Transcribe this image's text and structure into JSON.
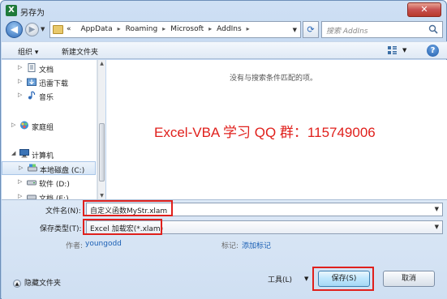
{
  "window": {
    "title": "另存为",
    "app_icon_letter": "X",
    "close_glyph": "✕"
  },
  "nav": {
    "back_glyph": "◀",
    "forward_glyph": "▶",
    "crumbs_prefix": "«",
    "breadcrumbs": [
      "AppData",
      "Roaming",
      "Microsoft",
      "AddIns"
    ],
    "search_placeholder": "搜索 AddIns"
  },
  "toolbar": {
    "organize_label": "组织 ▾",
    "new_folder_label": "新建文件夹"
  },
  "sidebar": {
    "items": [
      {
        "label": "文档",
        "icon": "document-icon"
      },
      {
        "label": "迅雷下载",
        "icon": "download-icon"
      },
      {
        "label": "音乐",
        "icon": "music-icon"
      },
      {
        "label": "家庭组",
        "icon": "homegroup-icon"
      },
      {
        "label": "计算机",
        "icon": "computer-icon"
      },
      {
        "label": "本地磁盘 (C:)",
        "icon": "drive-icon"
      },
      {
        "label": "软件 (D:)",
        "icon": "drive-icon"
      },
      {
        "label": "文档 (E:)",
        "icon": "drive-icon"
      }
    ]
  },
  "content": {
    "empty_message": "没有与搜索条件匹配的项。",
    "watermark": "Excel-VBA 学习 QQ 群：115749006"
  },
  "form": {
    "filename_label": "文件名(N):",
    "filename_value": "自定义函数MyStr.xlam",
    "filetype_label": "保存类型(T):",
    "filetype_value": "Excel 加载宏(*.xlam)",
    "author_label": "作者:",
    "author_value": "youngodd",
    "tags_label": "标记:",
    "tags_value": "添加标记"
  },
  "footer": {
    "hide_folders_label": "隐藏文件夹",
    "tools_label": "工具(L)",
    "save_label": "保存(S)",
    "cancel_label": "取消"
  },
  "colors": {
    "highlight": "#e0201c",
    "link": "#1a5fb4",
    "title_bar": "#b9d1ee"
  }
}
